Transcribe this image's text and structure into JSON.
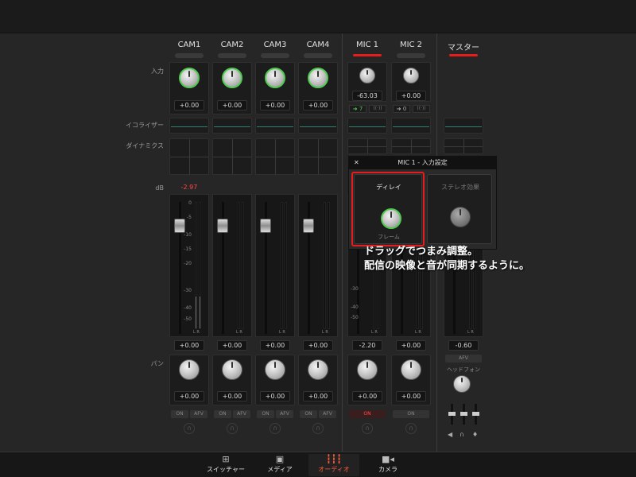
{
  "row_labels": {
    "input": "入力",
    "equalizer": "イコライザー",
    "dynamics": "ダイナミクス",
    "db": "dB",
    "pan": "パン"
  },
  "strips": [
    {
      "name": "CAM1",
      "input_value": "+0.00",
      "peak": "-2.97",
      "fader_value": "+0.00",
      "pan_value": "+0.00",
      "on": "ON",
      "afv": "AFV"
    },
    {
      "name": "CAM2",
      "input_value": "+0.00",
      "fader_value": "+0.00",
      "pan_value": "+0.00",
      "on": "ON",
      "afv": "AFV"
    },
    {
      "name": "CAM3",
      "input_value": "+0.00",
      "fader_value": "+0.00",
      "pan_value": "+0.00",
      "on": "ON",
      "afv": "AFV"
    },
    {
      "name": "CAM4",
      "input_value": "+0.00",
      "fader_value": "+0.00",
      "pan_value": "+0.00",
      "on": "ON",
      "afv": "AFV"
    },
    {
      "name": "MIC 1",
      "input_value": "-63.03",
      "delay_tag": "7",
      "fader_value": "-2.20",
      "pan_value": "+0.00",
      "on": "ON"
    },
    {
      "name": "MIC 2",
      "input_value": "+0.00",
      "delay_tag": "0",
      "fader_value": "+0.00",
      "pan_value": "+0.00",
      "on": "ON"
    }
  ],
  "master": {
    "name": "マスター",
    "fader_value": "-0.60",
    "afv": "AFV",
    "headphone": "ヘッドフォン"
  },
  "fader_scale": [
    "0",
    "-5",
    "-10",
    "-15",
    "-20",
    "-30",
    "-40",
    "-50"
  ],
  "meter_lr": "L R",
  "popup": {
    "close": "✕",
    "title": "MIC 1 - 入力設定",
    "delay_title": "ディレイ",
    "delay_unit": "フレーム",
    "stereo_title": "ステレオ効果"
  },
  "caption": {
    "line1": "ドラッグでつまみ調整。",
    "line2": "配信の映像と音が同期するように。"
  },
  "bottom_tabs": [
    {
      "label": "スイッチャー",
      "icon": "switcher-icon",
      "active": false
    },
    {
      "label": "メディア",
      "icon": "media-icon",
      "active": false
    },
    {
      "label": "オーディオ",
      "icon": "audio-icon",
      "active": true
    },
    {
      "label": "カメラ",
      "icon": "camera-icon",
      "active": false
    }
  ],
  "colors": {
    "accent": "#e81c1c",
    "knob_ring": "#4ecb4e",
    "active_tab": "#ff5a3a"
  }
}
